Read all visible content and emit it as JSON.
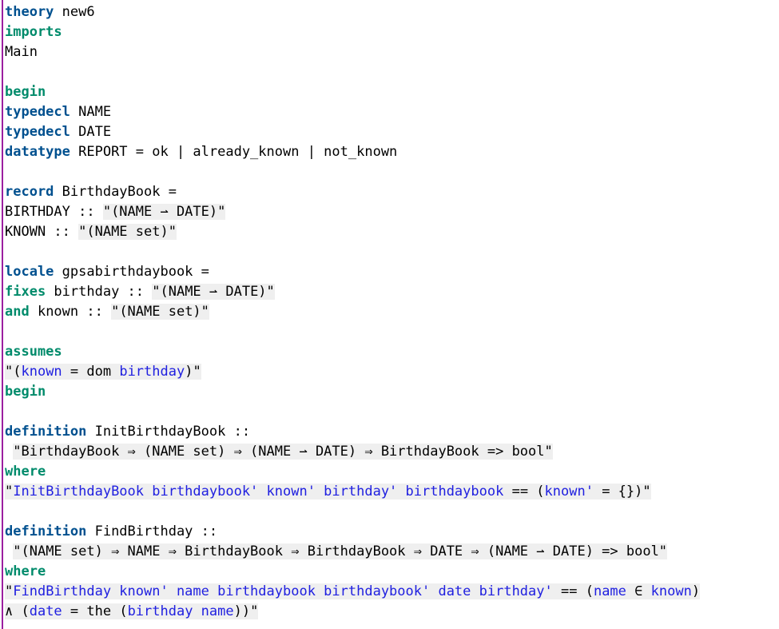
{
  "editor": {
    "accent_gutter_color": "#9b1fa0",
    "keyword_green_color": "#008b6b",
    "keyword_blue_color": "#00508f",
    "free_var_color": "#2020e0",
    "string_bg_color": "#efefef",
    "lines": [
      [
        {
          "t": "theory",
          "c": "kw-blue"
        },
        {
          "t": " new6"
        }
      ],
      [
        {
          "t": "imports",
          "c": "kw-green"
        }
      ],
      [
        {
          "t": "Main"
        }
      ],
      [],
      [
        {
          "t": "begin",
          "c": "kw-green"
        }
      ],
      [
        {
          "t": "typedecl",
          "c": "kw-blue"
        },
        {
          "t": " NAME"
        }
      ],
      [
        {
          "t": "typedecl",
          "c": "kw-blue"
        },
        {
          "t": " DATE"
        }
      ],
      [
        {
          "t": "datatype",
          "c": "kw-blue"
        },
        {
          "t": " REPORT = ok | already_known | not_known"
        }
      ],
      [],
      [
        {
          "t": "record",
          "c": "kw-blue"
        },
        {
          "t": " BirthdayBook ="
        }
      ],
      [
        {
          "t": "BIRTHDAY :: "
        },
        {
          "t": "\"(NAME ⇀ DATE)\"",
          "c": "str"
        }
      ],
      [
        {
          "t": "KNOWN :: "
        },
        {
          "t": "\"(NAME set)\"",
          "c": "str"
        }
      ],
      [],
      [
        {
          "t": "locale",
          "c": "kw-blue"
        },
        {
          "t": " gpsabirthdaybook ="
        }
      ],
      [
        {
          "t": "fixes",
          "c": "kw-green"
        },
        {
          "t": " birthday :: "
        },
        {
          "t": "\"(NAME ⇀ DATE)\"",
          "c": "str"
        }
      ],
      [
        {
          "t": "and",
          "c": "kw-green"
        },
        {
          "t": " known :: "
        },
        {
          "t": "\"(NAME set)\"",
          "c": "str"
        }
      ],
      [],
      [
        {
          "t": "assumes",
          "c": "kw-green"
        }
      ],
      [
        {
          "t": "\"(",
          "c": "str"
        },
        {
          "t": "known",
          "c": "str var"
        },
        {
          "t": " = dom ",
          "c": "str"
        },
        {
          "t": "birthday",
          "c": "str var"
        },
        {
          "t": ")\"",
          "c": "str"
        }
      ],
      [
        {
          "t": "begin",
          "c": "kw-green"
        }
      ],
      [],
      [
        {
          "t": "definition",
          "c": "kw-blue"
        },
        {
          "t": " InitBirthdayBook ::"
        }
      ],
      [
        {
          "t": " "
        },
        {
          "t": "\"BirthdayBook ⇒ (NAME set) ⇒ (NAME ⇀ DATE) ⇒ BirthdayBook => bool\"",
          "c": "str"
        }
      ],
      [
        {
          "t": "where",
          "c": "kw-green"
        }
      ],
      [
        {
          "t": "\"",
          "c": "str"
        },
        {
          "t": "InitBirthdayBook birthdaybook' known' birthday' birthdaybook",
          "c": "str var"
        },
        {
          "t": " == (",
          "c": "str"
        },
        {
          "t": "known'",
          "c": "str var"
        },
        {
          "t": " = {})\"",
          "c": "str"
        }
      ],
      [],
      [
        {
          "t": "definition",
          "c": "kw-blue"
        },
        {
          "t": " FindBirthday ::"
        }
      ],
      [
        {
          "t": " "
        },
        {
          "t": "\"(NAME set) ⇒ NAME ⇒ BirthdayBook ⇒ BirthdayBook ⇒ DATE ⇒ (NAME ⇀ DATE) => bool\"",
          "c": "str"
        }
      ],
      [
        {
          "t": "where",
          "c": "kw-green"
        }
      ],
      [
        {
          "t": "\"",
          "c": "str"
        },
        {
          "t": "FindBirthday known' name birthdaybook birthdaybook' date birthday'",
          "c": "str var"
        },
        {
          "t": " == (",
          "c": "str"
        },
        {
          "t": "name",
          "c": "str var"
        },
        {
          "t": " ∈ ",
          "c": "str"
        },
        {
          "t": "known",
          "c": "str var"
        },
        {
          "t": ")",
          "c": "str"
        }
      ],
      [
        {
          "t": "∧ (",
          "c": "str"
        },
        {
          "t": "date",
          "c": "str var"
        },
        {
          "t": " = the (",
          "c": "str"
        },
        {
          "t": "birthday name",
          "c": "str var"
        },
        {
          "t": "))\"",
          "c": "str"
        }
      ]
    ]
  }
}
